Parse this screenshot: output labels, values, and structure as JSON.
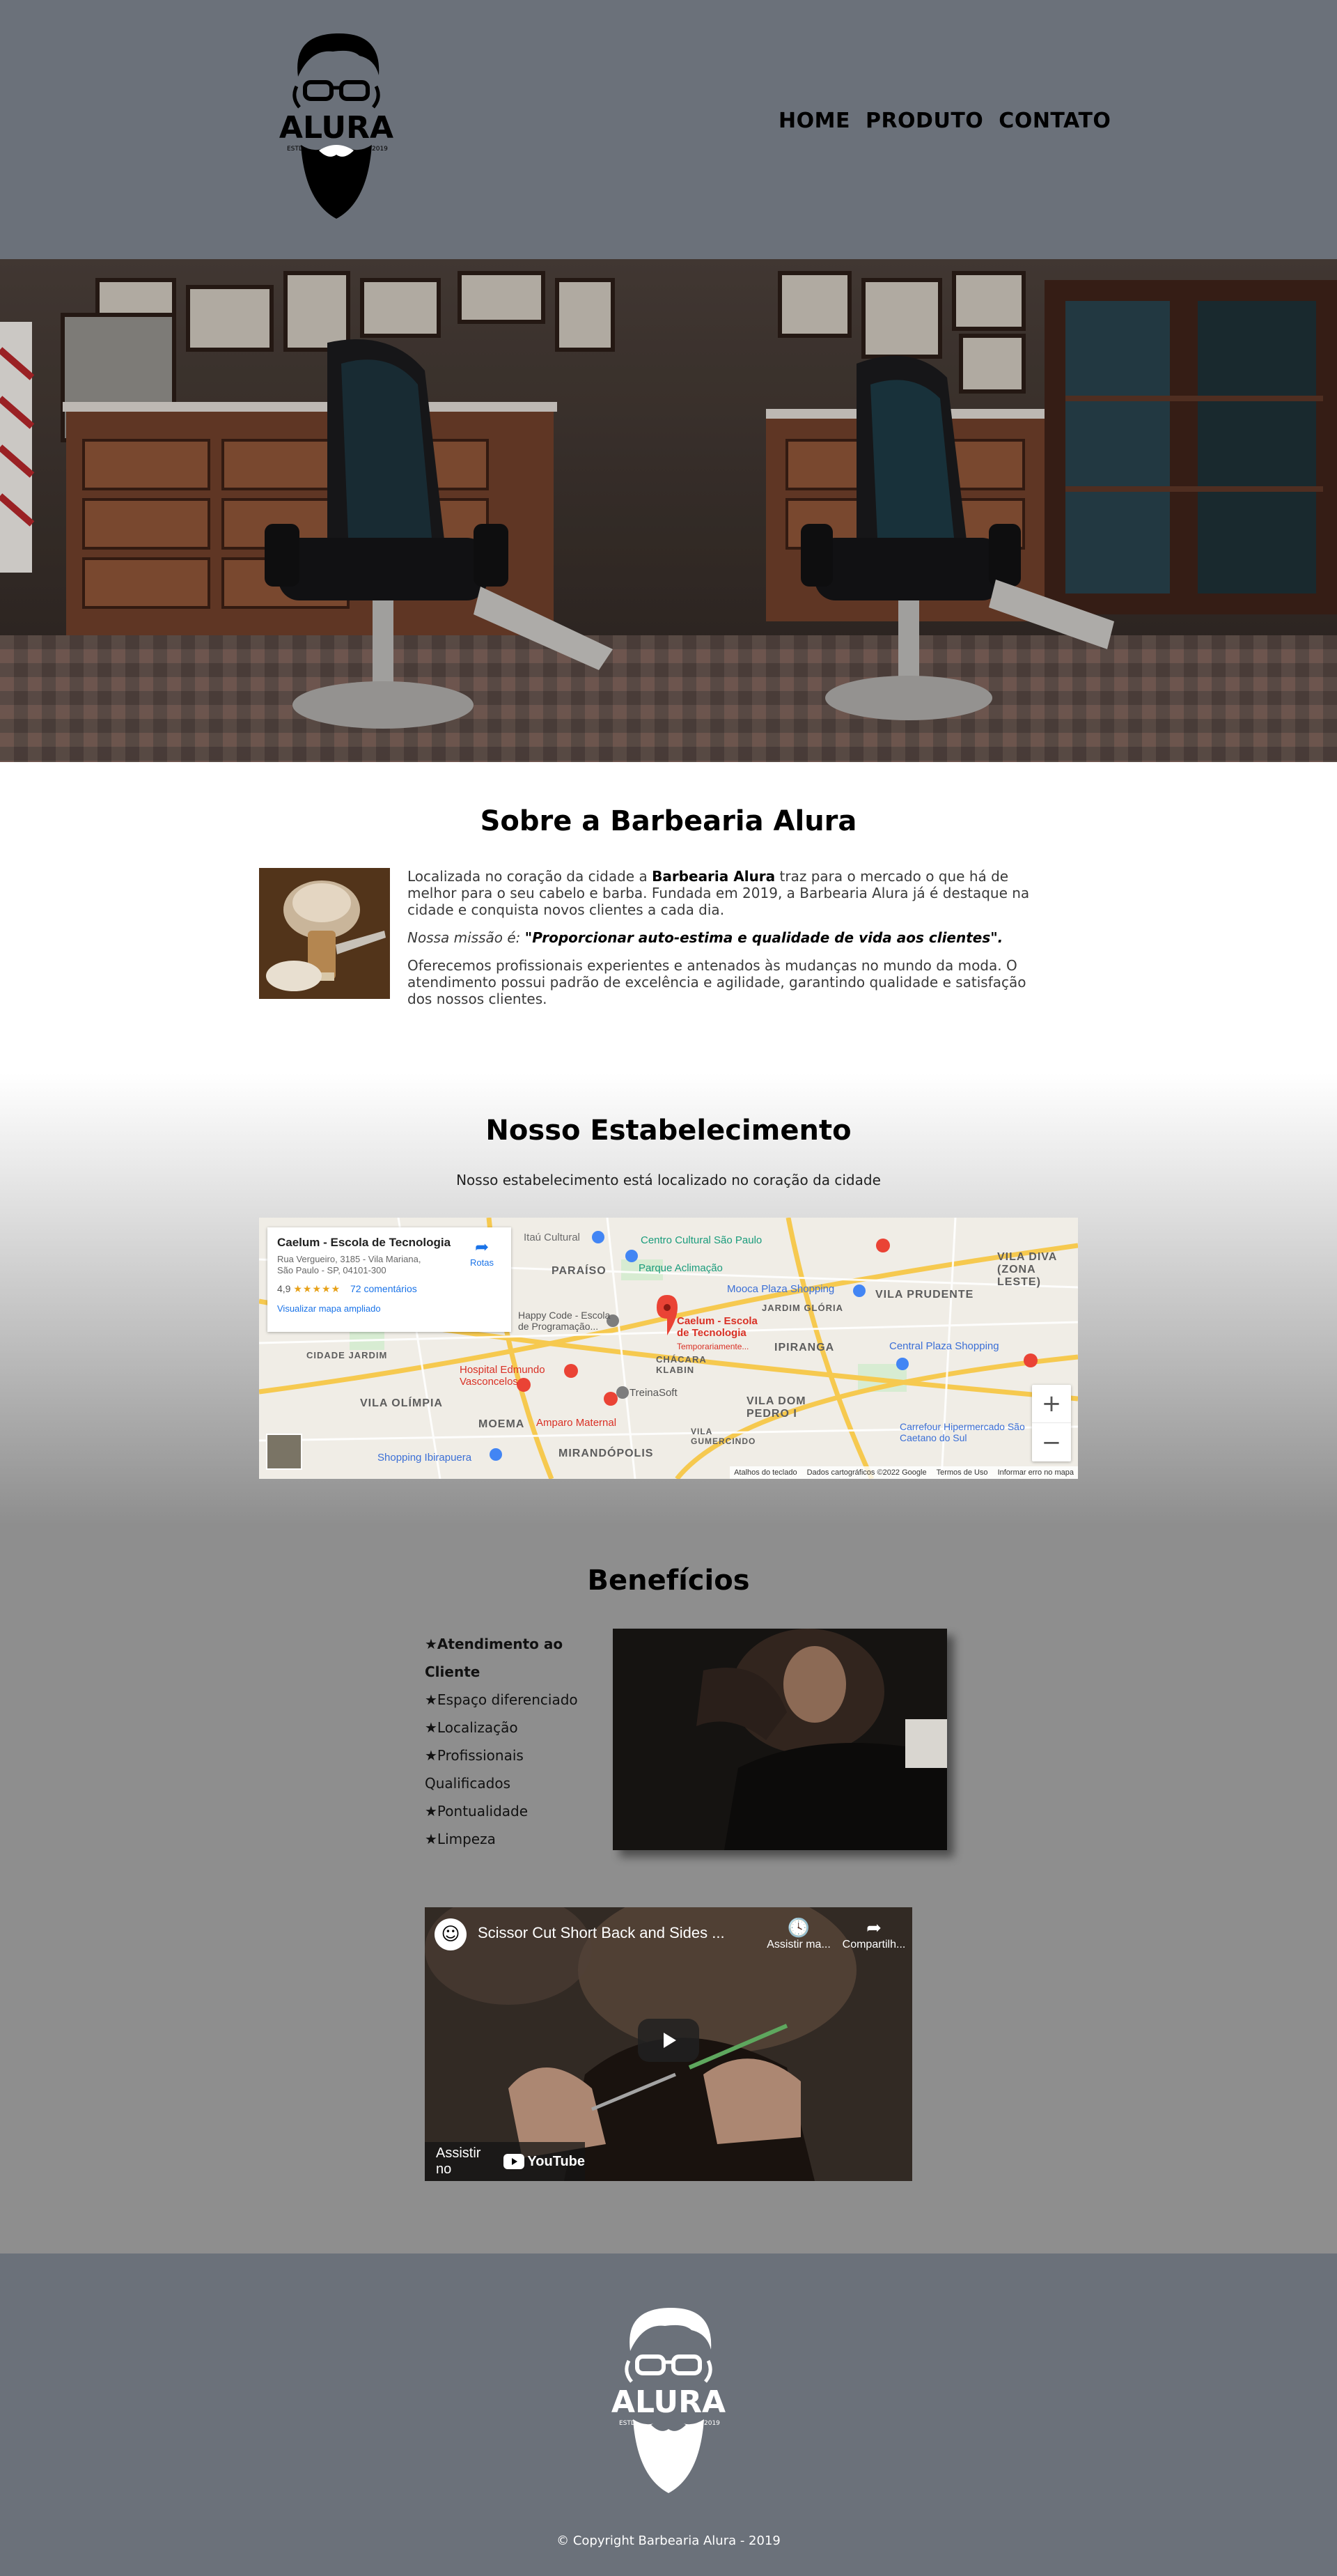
{
  "brand": {
    "name": "ALURA",
    "estd": "ESTD",
    "year": "2019"
  },
  "nav": {
    "items": [
      "HOME",
      "PRODUTO",
      "CONTATO"
    ]
  },
  "sobre": {
    "title": "Sobre a Barbearia Alura",
    "p1_before": "Localizada no coração da cidade a ",
    "p1_strong": "Barbearia Alura",
    "p1_after": " traz para o mercado o que há de melhor para o seu cabelo e barba. Fundada em 2019, a Barbearia Alura já é destaque na cidade e conquista novos clientes a cada dia.",
    "mission_label": "Nossa missão é: ",
    "mission_text": "\"Proporcionar auto-estima e qualidade de vida aos clientes\".",
    "p3": "Oferecemos profissionais experientes e antenados às mudanças no mundo da moda. O atendimento possui padrão de excelência e agilidade, garantindo qualidade e satisfação dos nossos clientes."
  },
  "estabelecimento": {
    "title": "Nosso Estabelecimento",
    "subtitle": "Nosso estabelecimento está localizado no coração da cidade",
    "map": {
      "place": "Caelum - Escola de Tecnologia",
      "address": "Rua Vergueiro, 3185 - Vila Mariana, São Paulo - SP, 04101-300",
      "rating": "4,9",
      "stars": "★★★★★",
      "reviews": "72 comentários",
      "enlarge": "Visualizar mapa ampliado",
      "directions": "Rotas",
      "marker_label": "Caelum - Escola de Tecnologia",
      "marker_sub": "Temporariamente...",
      "footer": [
        "Atalhos do teclado",
        "Dados cartográficos ©2022 Google",
        "Termos de Uso",
        "Informar erro no mapa"
      ],
      "labels": [
        "PARAÍSO",
        "VILA PRUDENTE",
        "IPIRANGA",
        "VILA OLÍMPIA",
        "MOEMA",
        "VILA DOM PEDRO I",
        "CHÁCARA KLABIN",
        "JARDIM GLÓRIA",
        "CIDADE JARDIM",
        "MIRANDÓPOLIS",
        "VILA DIVA (ZONA LESTE)",
        "VILA GUMERCINDO"
      ],
      "pois": [
        "Itaú Cultural",
        "Centro Cultural São Paulo",
        "Parque Aclimação",
        "Mooca Plaza Shopping",
        "Central Plaza Shopping",
        "Hospital Edmundo Vasconcelos",
        "Amparo Maternal",
        "TreinaSoft",
        "Shopping Ibirapuera",
        "Carrefour Hipermercado São Caetano do Sul",
        "Happy Code - Escola de Programação..."
      ]
    }
  },
  "beneficios": {
    "title": "Benefícios",
    "items": [
      "★Atendimento ao Cliente",
      "★Espaço diferenciado",
      "★Localização",
      "★Profissionais Qualificados",
      "★Pontualidade",
      "★Limpeza"
    ],
    "video": {
      "title": "Scissor Cut Short Back and Sides ...",
      "watch_later": "Assistir ma...",
      "share": "Compartilh...",
      "watch_on": "Assistir no",
      "youtube": "YouTube"
    }
  },
  "footer": {
    "copyright": "© Copyright Barbearia Alura - 2019"
  },
  "colors": {
    "header_bg": "#6b717a",
    "body_bg": "#8e8e8e",
    "text": "#000000"
  }
}
